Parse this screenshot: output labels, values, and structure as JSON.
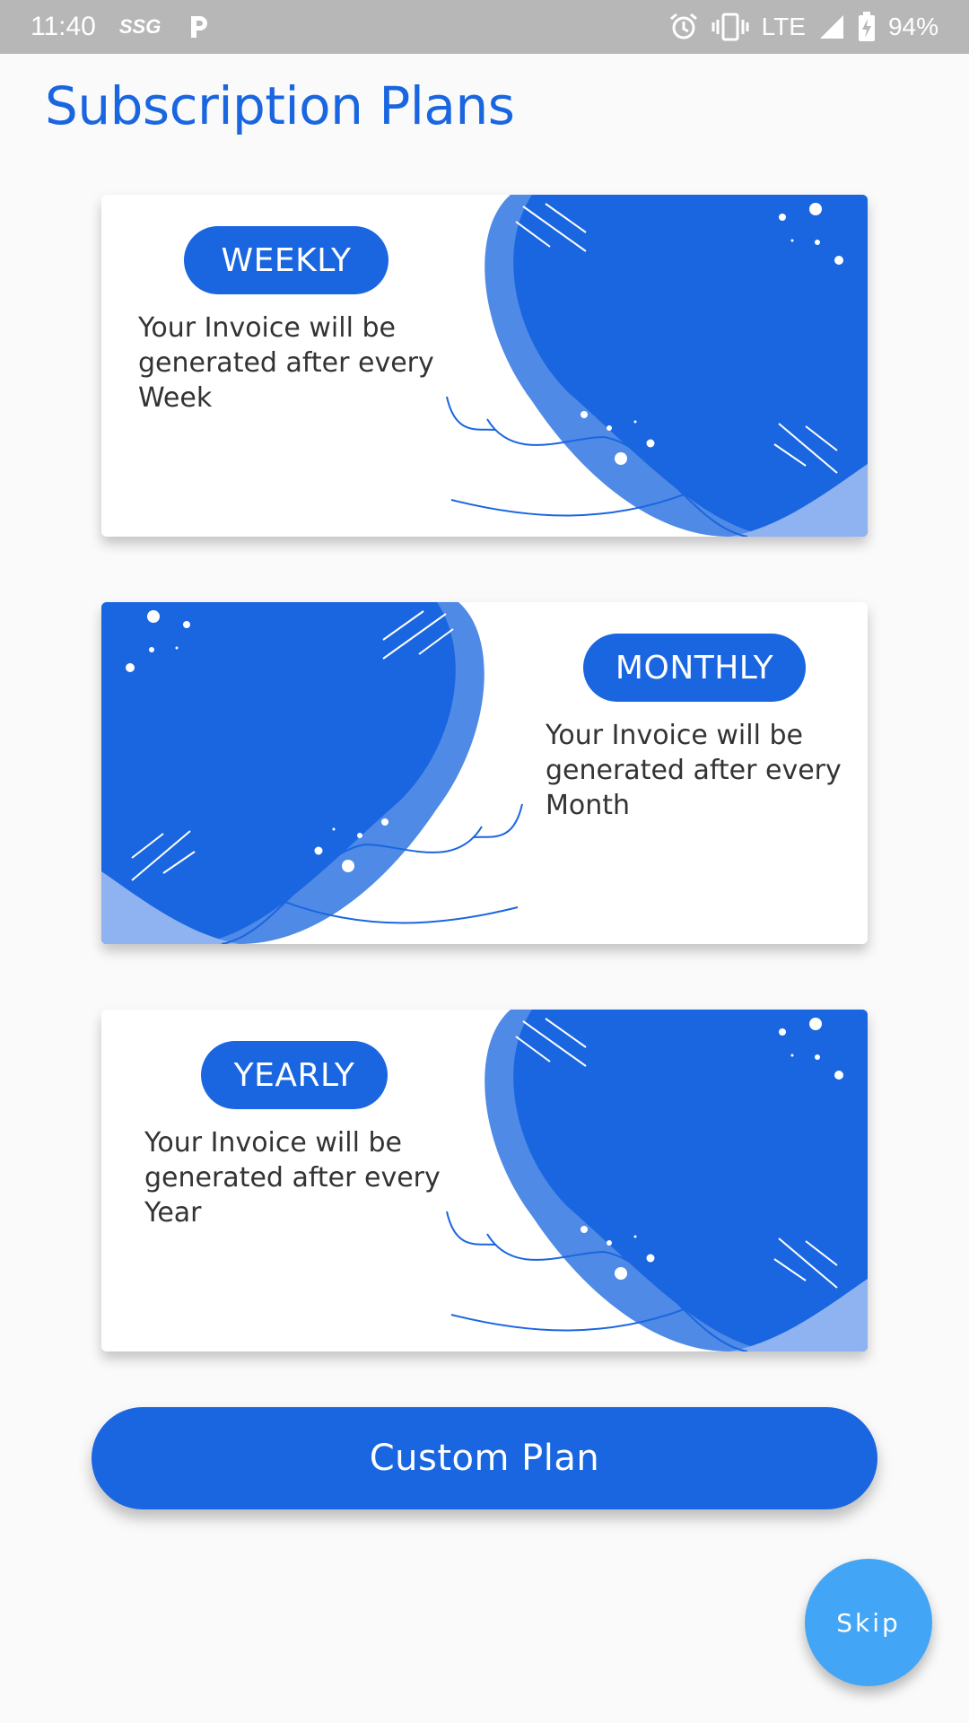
{
  "status_bar": {
    "time": "11:40",
    "carrier_label": "SSG",
    "network": "LTE",
    "battery": "94%",
    "icons": [
      "ssg-icon",
      "parking-icon",
      "alarm-icon",
      "vibrate-icon",
      "signal-icon",
      "battery-charging-icon"
    ]
  },
  "page": {
    "title": "Subscription Plans"
  },
  "plans": [
    {
      "label": "WEEKLY",
      "description": "Your Invoice will be generated after every Week"
    },
    {
      "label": "MONTHLY",
      "description": "Your Invoice will be generated after every Month"
    },
    {
      "label": "YEARLY",
      "description": "Your Invoice will be generated after every Year"
    }
  ],
  "actions": {
    "custom_plan_label": "Custom Plan",
    "skip_label": "Skip"
  },
  "colors": {
    "accent": "#1a66e0",
    "accent_light": "#4f8ae6",
    "accent_pale": "#8fb3f0",
    "skip": "#42a5f5",
    "status_bar": "#b7b7b7"
  }
}
